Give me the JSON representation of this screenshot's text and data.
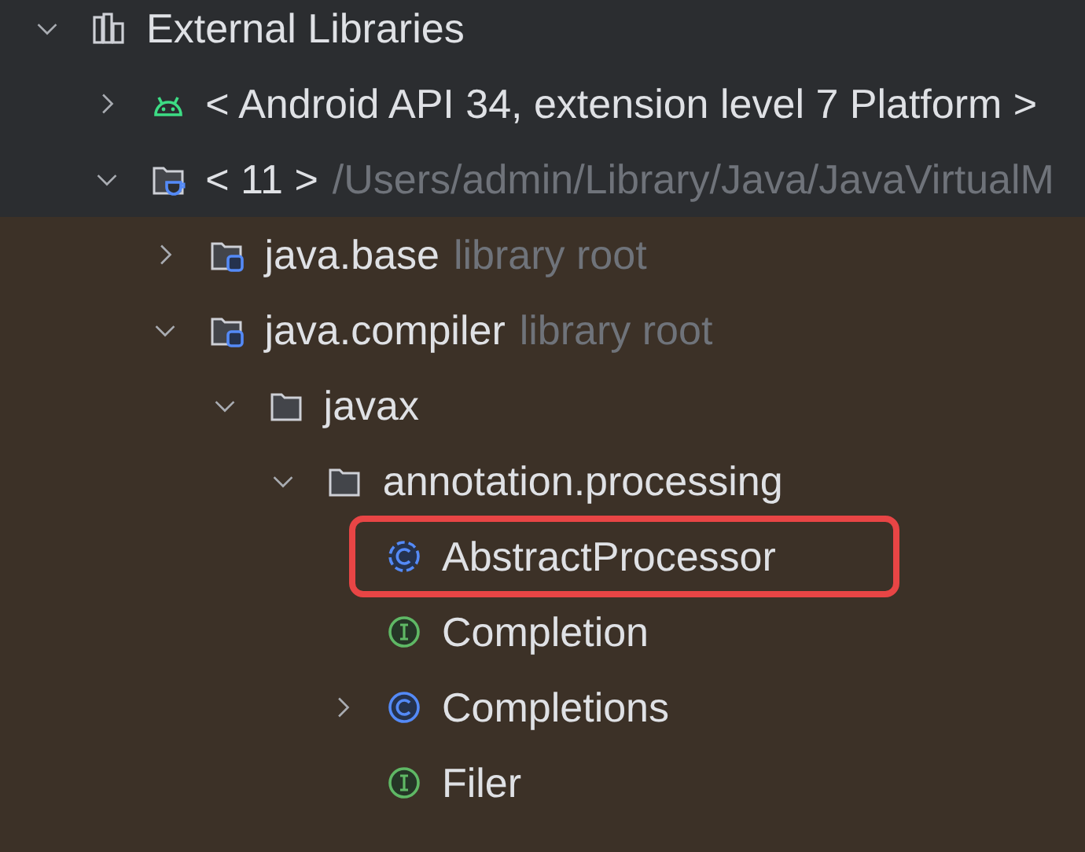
{
  "project_tree": [
    {
      "label": "External Libraries",
      "kind": "libraries",
      "expanded": true,
      "children": [
        {
          "label": "< Android API 34, extension level 7 Platform >",
          "kind": "android",
          "expanded": false
        },
        {
          "label": "< 11 >",
          "hint": "/Users/admin/Library/Java/JavaVirtualM",
          "kind": "jdk",
          "expanded": true,
          "scope": true,
          "children": [
            {
              "label": "java.base",
              "hint": "library root",
              "kind": "module",
              "expanded": false
            },
            {
              "label": "java.compiler",
              "hint": "library root",
              "kind": "module",
              "expanded": true,
              "children": [
                {
                  "label": "javax",
                  "kind": "folder",
                  "expanded": true,
                  "children": [
                    {
                      "label": "annotation.processing",
                      "kind": "folder",
                      "expanded": true,
                      "children": [
                        {
                          "label": "AbstractProcessor",
                          "kind": "abstract-class",
                          "highlighted": true
                        },
                        {
                          "label": "Completion",
                          "kind": "interface"
                        },
                        {
                          "label": "Completions",
                          "kind": "class",
                          "expanded": false
                        },
                        {
                          "label": "Filer",
                          "kind": "interface"
                        }
                      ]
                    }
                  ]
                }
              ]
            }
          ]
        }
      ]
    }
  ]
}
